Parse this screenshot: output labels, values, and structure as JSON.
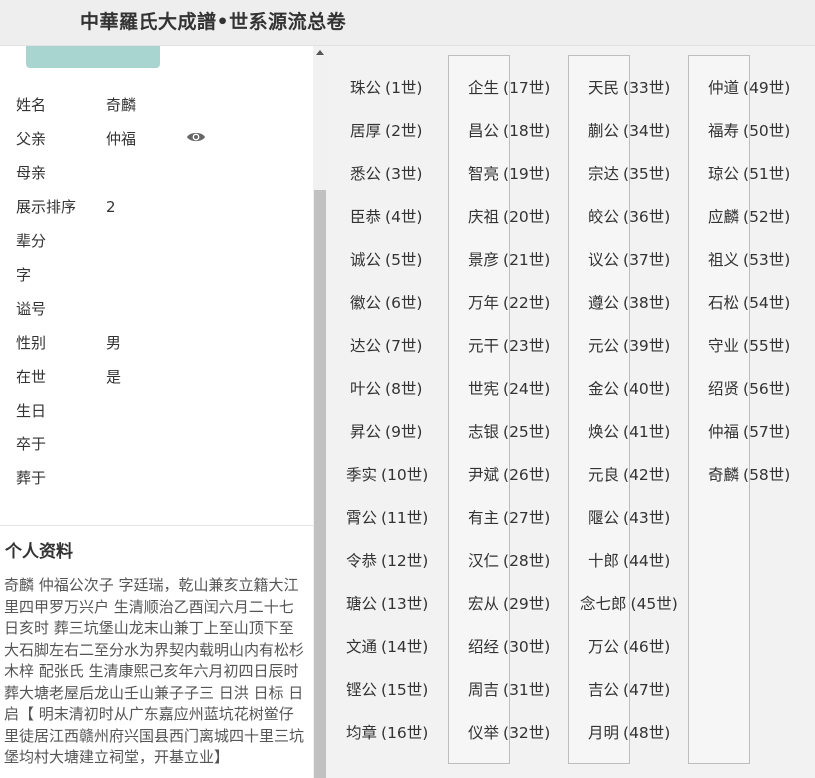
{
  "header": {
    "title": "中華羅氏大成譜•世系源流总卷"
  },
  "profile": {
    "fields": [
      {
        "label": "姓名",
        "value": "奇麟"
      },
      {
        "label": "父亲",
        "value": "仲福"
      },
      {
        "label": "母亲",
        "value": ""
      },
      {
        "label": "展示排序",
        "value": "2"
      },
      {
        "label": "辈分",
        "value": ""
      },
      {
        "label": "字",
        "value": ""
      },
      {
        "label": "谥号",
        "value": ""
      },
      {
        "label": "性别",
        "value": "男"
      },
      {
        "label": "在世",
        "value": "是"
      },
      {
        "label": "生日",
        "value": ""
      },
      {
        "label": "卒于",
        "value": ""
      },
      {
        "label": "葬于",
        "value": ""
      }
    ],
    "view_icon": "eye-icon"
  },
  "bio": {
    "title": "个人资料",
    "text": "奇麟 仲福公次子 字廷瑞，乾山兼亥立籍大江里四甲罗万兴户 生清顺治乙酉闰六月二十七日亥时 葬三坑堡山龙末山兼丁上至山顶下至大石脚左右二至分水为界契内载明山内有松杉木梓 配张氏 生清康熙己亥年六月初四日辰时 葬大塘老屋后龙山壬山兼子子三 日洪 日标 日启【 明末清初时从广东嘉应州蓝坑花树鲎仔里徒居江西赣州府兴国县西门离城四十里三坑堡均村大塘建立祠堂，开基立业】"
  },
  "generations": [
    {
      "name": "珠公",
      "gen": "(1世)"
    },
    {
      "name": "居厚",
      "gen": "(2世)"
    },
    {
      "name": "悉公",
      "gen": "(3世)"
    },
    {
      "name": "臣恭",
      "gen": "(4世)"
    },
    {
      "name": "诚公",
      "gen": "(5世)"
    },
    {
      "name": "徽公",
      "gen": "(6世)"
    },
    {
      "name": "达公",
      "gen": "(7世)"
    },
    {
      "name": "叶公",
      "gen": "(8世)"
    },
    {
      "name": "昇公",
      "gen": "(9世)"
    },
    {
      "name": "季实",
      "gen": "(10世)"
    },
    {
      "name": "霄公",
      "gen": "(11世)"
    },
    {
      "name": "令恭",
      "gen": "(12世)"
    },
    {
      "name": "瑭公",
      "gen": "(13世)"
    },
    {
      "name": "文通",
      "gen": "(14世)"
    },
    {
      "name": "铿公",
      "gen": "(15世)"
    },
    {
      "name": "均章",
      "gen": "(16世)"
    },
    {
      "name": "企生",
      "gen": "(17世)"
    },
    {
      "name": "昌公",
      "gen": "(18世)"
    },
    {
      "name": "智亮",
      "gen": "(19世)"
    },
    {
      "name": "庆祖",
      "gen": "(20世)"
    },
    {
      "name": "景彦",
      "gen": "(21世)"
    },
    {
      "name": "万年",
      "gen": "(22世)"
    },
    {
      "name": "元干",
      "gen": "(23世)"
    },
    {
      "name": "世宪",
      "gen": "(24世)"
    },
    {
      "name": "志银",
      "gen": "(25世)"
    },
    {
      "name": "尹斌",
      "gen": "(26世)"
    },
    {
      "name": "有主",
      "gen": "(27世)"
    },
    {
      "name": "汉仁",
      "gen": "(28世)"
    },
    {
      "name": "宏从",
      "gen": "(29世)"
    },
    {
      "name": "绍经",
      "gen": "(30世)"
    },
    {
      "name": "周吉",
      "gen": "(31世)"
    },
    {
      "name": "仪举",
      "gen": "(32世)"
    },
    {
      "name": "天民",
      "gen": "(33世)"
    },
    {
      "name": "蒯公",
      "gen": "(34世)"
    },
    {
      "name": "宗达",
      "gen": "(35世)"
    },
    {
      "name": "皎公",
      "gen": "(36世)"
    },
    {
      "name": "议公",
      "gen": "(37世)"
    },
    {
      "name": "遵公",
      "gen": "(38世)"
    },
    {
      "name": "元公",
      "gen": "(39世)"
    },
    {
      "name": "金公",
      "gen": "(40世)"
    },
    {
      "name": "焕公",
      "gen": "(41世)"
    },
    {
      "name": "元良",
      "gen": "(42世)"
    },
    {
      "name": "隁公",
      "gen": "(43世)"
    },
    {
      "name": "十郎",
      "gen": "(44世)"
    },
    {
      "name": "念七郎",
      "gen": "(45世)"
    },
    {
      "name": "万公",
      "gen": "(46世)"
    },
    {
      "name": "吉公",
      "gen": "(47世)"
    },
    {
      "name": "月明",
      "gen": "(48世)"
    },
    {
      "name": "仲道",
      "gen": "(49世)"
    },
    {
      "name": "福寿",
      "gen": "(50世)"
    },
    {
      "name": "琼公",
      "gen": "(51世)"
    },
    {
      "name": "应麟",
      "gen": "(52世)"
    },
    {
      "name": "祖义",
      "gen": "(53世)"
    },
    {
      "name": "石松",
      "gen": "(54世)"
    },
    {
      "name": "守业",
      "gen": "(55世)"
    },
    {
      "name": "绍贤",
      "gen": "(56世)"
    },
    {
      "name": "仲福",
      "gen": "(57世)"
    },
    {
      "name": "奇麟",
      "gen": "(58世)"
    }
  ]
}
